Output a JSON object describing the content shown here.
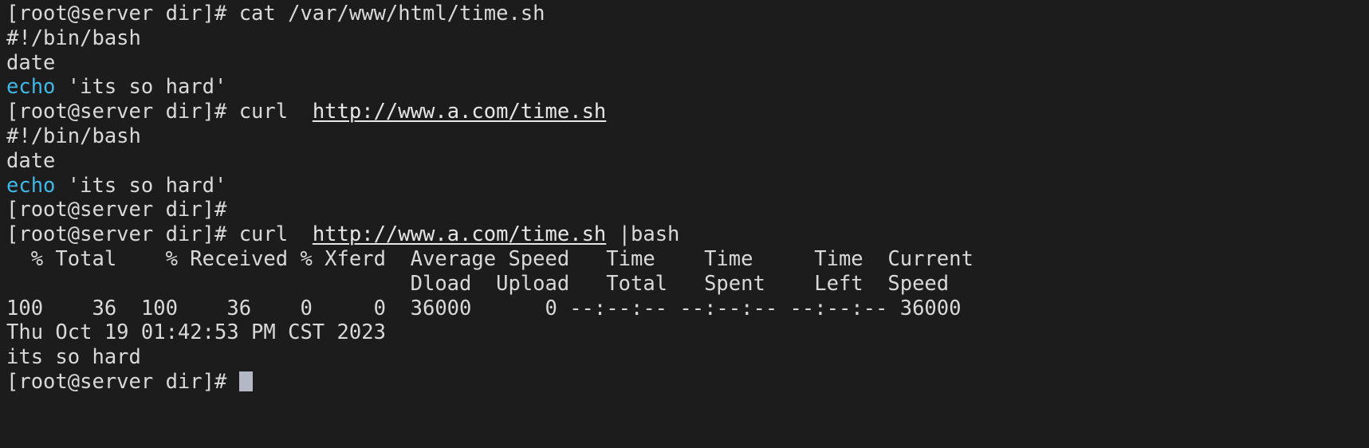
{
  "terminal": {
    "window_title": "",
    "background_color": "#1c1c1c",
    "foreground_color": "#d9d9d9",
    "keyword_color": "#3fb8e8",
    "cursor_color": "#b4b7c4",
    "prompt": "[root@server dir]#",
    "lines": [
      {
        "id": "line-1-cat-command",
        "kind": "command",
        "segments": [
          {
            "text": "[root@server dir]# cat /var/www/html/time.sh",
            "style": "default"
          }
        ]
      },
      {
        "id": "line-2-shebang",
        "kind": "output",
        "segments": [
          {
            "text": "#!/bin/bash",
            "style": "default"
          }
        ]
      },
      {
        "id": "line-3-date",
        "kind": "output",
        "segments": [
          {
            "text": "date",
            "style": "default"
          }
        ]
      },
      {
        "id": "line-4-echo",
        "kind": "output",
        "segments": [
          {
            "text": "echo",
            "style": "cyan"
          },
          {
            "text": " 'its so hard'",
            "style": "default"
          }
        ]
      },
      {
        "id": "line-5-curl-command",
        "kind": "command",
        "segments": [
          {
            "text": "[root@server dir]# curl  ",
            "style": "default"
          },
          {
            "text": "http://www.a.com/time.sh",
            "style": "url"
          }
        ]
      },
      {
        "id": "line-6-shebang",
        "kind": "output",
        "segments": [
          {
            "text": "#!/bin/bash",
            "style": "default"
          }
        ]
      },
      {
        "id": "line-7-date",
        "kind": "output",
        "segments": [
          {
            "text": "date",
            "style": "default"
          }
        ]
      },
      {
        "id": "line-8-echo",
        "kind": "output",
        "segments": [
          {
            "text": "echo",
            "style": "cyan"
          },
          {
            "text": " 'its so hard'",
            "style": "default"
          }
        ]
      },
      {
        "id": "line-9-empty-prompt",
        "kind": "command",
        "segments": [
          {
            "text": "[root@server dir]#",
            "style": "default"
          }
        ]
      },
      {
        "id": "line-10-curl-pipe-bash",
        "kind": "command",
        "segments": [
          {
            "text": "[root@server dir]# curl  ",
            "style": "default"
          },
          {
            "text": "http://www.a.com/time.sh",
            "style": "url"
          },
          {
            "text": " |bash",
            "style": "default"
          }
        ]
      },
      {
        "id": "line-11-curl-header-1",
        "kind": "output",
        "segments": [
          {
            "text": "  % Total    % Received % Xferd  Average Speed   Time    Time     Time  Current",
            "style": "default"
          }
        ]
      },
      {
        "id": "line-12-curl-header-2",
        "kind": "output",
        "segments": [
          {
            "text": "                                 Dload  Upload   Total   Spent    Left  Speed",
            "style": "default"
          }
        ]
      },
      {
        "id": "line-13-curl-stats",
        "kind": "output",
        "segments": [
          {
            "text": "100    36  100    36    0     0  36000      0 --:--:-- --:--:-- --:--:-- 36000",
            "style": "default"
          }
        ]
      },
      {
        "id": "line-14-date-output",
        "kind": "output",
        "segments": [
          {
            "text": "Thu Oct 19 01:42:53 PM CST 2023",
            "style": "default"
          }
        ]
      },
      {
        "id": "line-15-echo-output",
        "kind": "output",
        "segments": [
          {
            "text": "its so hard",
            "style": "default"
          }
        ]
      },
      {
        "id": "line-16-final-prompt",
        "kind": "command",
        "segments": [
          {
            "text": "[root@server dir]# ",
            "style": "default"
          },
          {
            "text": "",
            "style": "cursor"
          }
        ]
      }
    ],
    "curl_progress": {
      "columns": [
        "% Total",
        "% Received",
        "% Xferd",
        "Average Speed Dload",
        "Average Speed Upload",
        "Time Total",
        "Time Spent",
        "Time Left",
        "Current Speed"
      ],
      "values": [
        "100",
        "36",
        "100",
        "36",
        "0",
        "0",
        "36000",
        "0",
        "--:--:--",
        "--:--:--",
        "--:--:--",
        "36000"
      ]
    }
  }
}
